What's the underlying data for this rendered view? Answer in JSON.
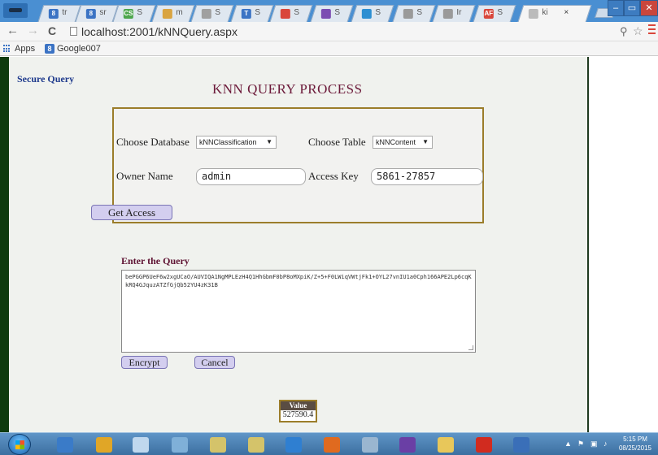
{
  "browser": {
    "tabs": [
      {
        "label": "tr",
        "color": "#3b73c4",
        "glyph": "8"
      },
      {
        "label": "sr",
        "color": "#3b73c4",
        "glyph": "8"
      },
      {
        "label": "S",
        "color": "#4ca64c",
        "glyph": "CS"
      },
      {
        "label": "m",
        "color": "#d9a441",
        "glyph": ""
      },
      {
        "label": "S",
        "color": "#a0a0a0",
        "glyph": ""
      },
      {
        "label": "S",
        "color": "#3b73c4",
        "glyph": "T"
      },
      {
        "label": "S",
        "color": "#d9463b",
        "glyph": ""
      },
      {
        "label": "S",
        "color": "#7b4db2",
        "glyph": ""
      },
      {
        "label": "S",
        "color": "#2d8fd2",
        "glyph": ""
      },
      {
        "label": "S",
        "color": "#9a9a9a",
        "glyph": ""
      },
      {
        "label": "Ir",
        "color": "#9a9a9a",
        "glyph": ""
      },
      {
        "label": "S",
        "color": "#d9463b",
        "glyph": "AF"
      },
      {
        "label": "ki",
        "color": "#bbbbbb",
        "glyph": "",
        "close": "×"
      }
    ],
    "url": "localhost:2001/kNNQuery.aspx",
    "back": "←",
    "forward": "→",
    "reload": "C",
    "window_controls": {
      "minimize": "–",
      "restore": "▭",
      "close": "✕"
    }
  },
  "bookmarks": {
    "apps_label": "Apps",
    "google_icon": "8",
    "google_label": "Google007"
  },
  "page": {
    "secure_link": "Secure Query",
    "title": "KNN QUERY PROCESS",
    "choose_database_label": "Choose Database",
    "database_value": "kNNClassification",
    "choose_table_label": "Choose Table",
    "table_value": "kNNContent",
    "owner_name_label": "Owner Name",
    "owner_name_value": "admin",
    "access_key_label": "Access Key",
    "access_key_value": "5861-27857",
    "get_access_button": "Get Access",
    "query_label": "Enter the Query",
    "query_text": "bePGGP6UeF6w2xgUCaO/AUVIQA1NgMPLEzH4Q1HhGbmF0bP8oMXpiK/Z+5+F0LWiqVWtjFk1+OYL27vnIU1a0Cph166APE2Lp6cqKkRQ4GJquzATZfGjQb52YU4zK31B",
    "encrypt_button": "Encrypt",
    "cancel_button": "Cancel",
    "value_header": "Value",
    "value_number": "527590.4"
  },
  "taskbar": {
    "apps": [
      {
        "name": "ie",
        "color": "#3a7bc8"
      },
      {
        "name": "chrome",
        "color": "#e0a627"
      },
      {
        "name": "paint",
        "color": "#c0d8ee"
      },
      {
        "name": "notepad",
        "color": "#7fb0d8"
      },
      {
        "name": "network",
        "color": "#d4c36a"
      },
      {
        "name": "network2",
        "color": "#d4c36a"
      },
      {
        "name": "media",
        "color": "#2f7fd1"
      },
      {
        "name": "firefox",
        "color": "#e06a1f"
      },
      {
        "name": "sqlserver",
        "color": "#9ab6d0"
      },
      {
        "name": "visualstudio",
        "color": "#6a3fa5"
      },
      {
        "name": "explorer",
        "color": "#e8c75a"
      },
      {
        "name": "acrobat",
        "color": "#d12b1f"
      },
      {
        "name": "word",
        "color": "#3a6fb8"
      }
    ],
    "time": "5:15 PM",
    "date": "08/25/2015"
  }
}
